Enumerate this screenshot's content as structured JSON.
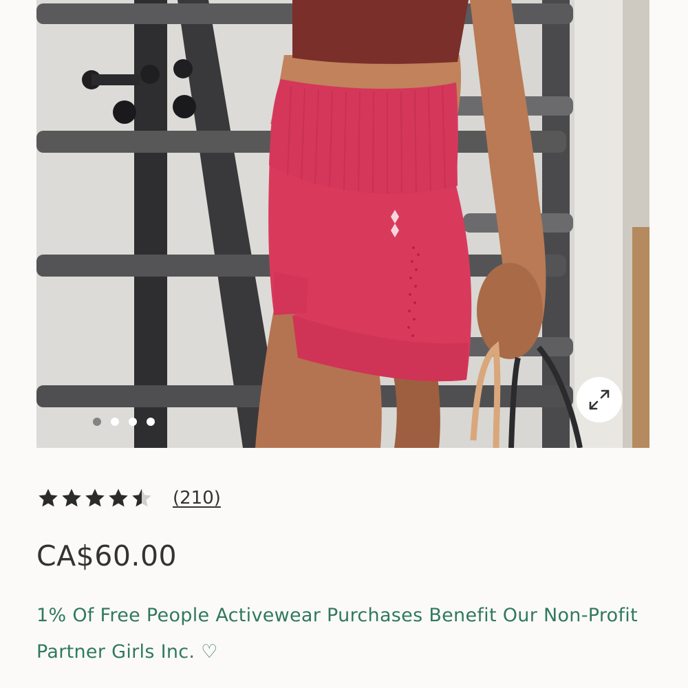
{
  "product": {
    "image": {
      "alt": "",
      "carousel_dots": 4,
      "active_dot": 0
    },
    "zoom_icon": "expand-arrows-icon",
    "rating": {
      "value": 4.5,
      "max": 5,
      "review_count_label": "(210)"
    },
    "price": "CA$60.00",
    "benefit_text": "1% Of Free People Activewear Purchases Benefit Our Non-Profit Partner Girls Inc. ♡"
  },
  "colors": {
    "background": "#fcfaf8",
    "text": "#333333",
    "benefit_text": "#2f7a5c",
    "star": "#2b2b2b",
    "star_empty": "#cfcfcf",
    "shorts": "#d93a5c"
  }
}
